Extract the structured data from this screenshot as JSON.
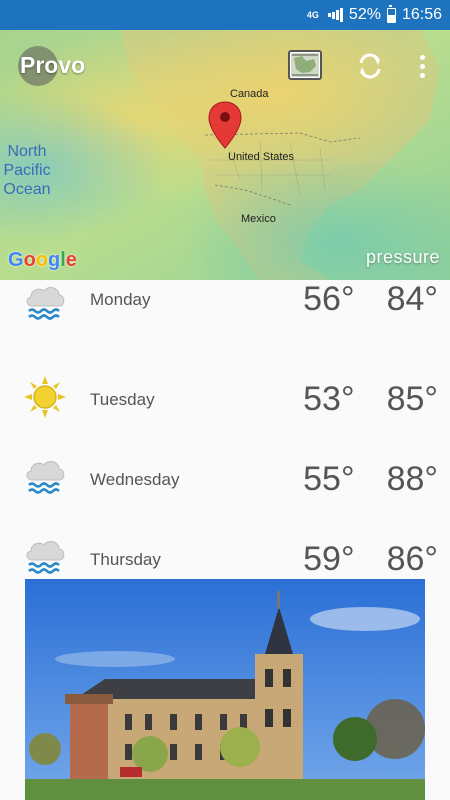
{
  "status_bar": {
    "network": "4G",
    "battery": "52%",
    "time": "16:56"
  },
  "header": {
    "city": "Provo"
  },
  "map": {
    "labels": {
      "canada": "Canada",
      "usa": "United States",
      "mexico": "Mexico",
      "ocean": "North Pacific Ocean"
    },
    "google": [
      "G",
      "o",
      "o",
      "g",
      "l",
      "e"
    ],
    "google_colors": [
      "#4285f4",
      "#ea4335",
      "#fbbc05",
      "#4285f4",
      "#34a853",
      "#ea4335"
    ],
    "layer": "pressure"
  },
  "forecast": [
    {
      "day": "Monday",
      "low": "56°",
      "high": "84°",
      "icon": "rain-cloud-icon"
    },
    {
      "day": "Tuesday",
      "low": "53°",
      "high": "85°",
      "icon": "sun-icon"
    },
    {
      "day": "Wednesday",
      "low": "55°",
      "high": "88°",
      "icon": "rain-cloud-icon"
    },
    {
      "day": "Thursday",
      "low": "59°",
      "high": "86°",
      "icon": "rain-cloud-icon"
    }
  ]
}
